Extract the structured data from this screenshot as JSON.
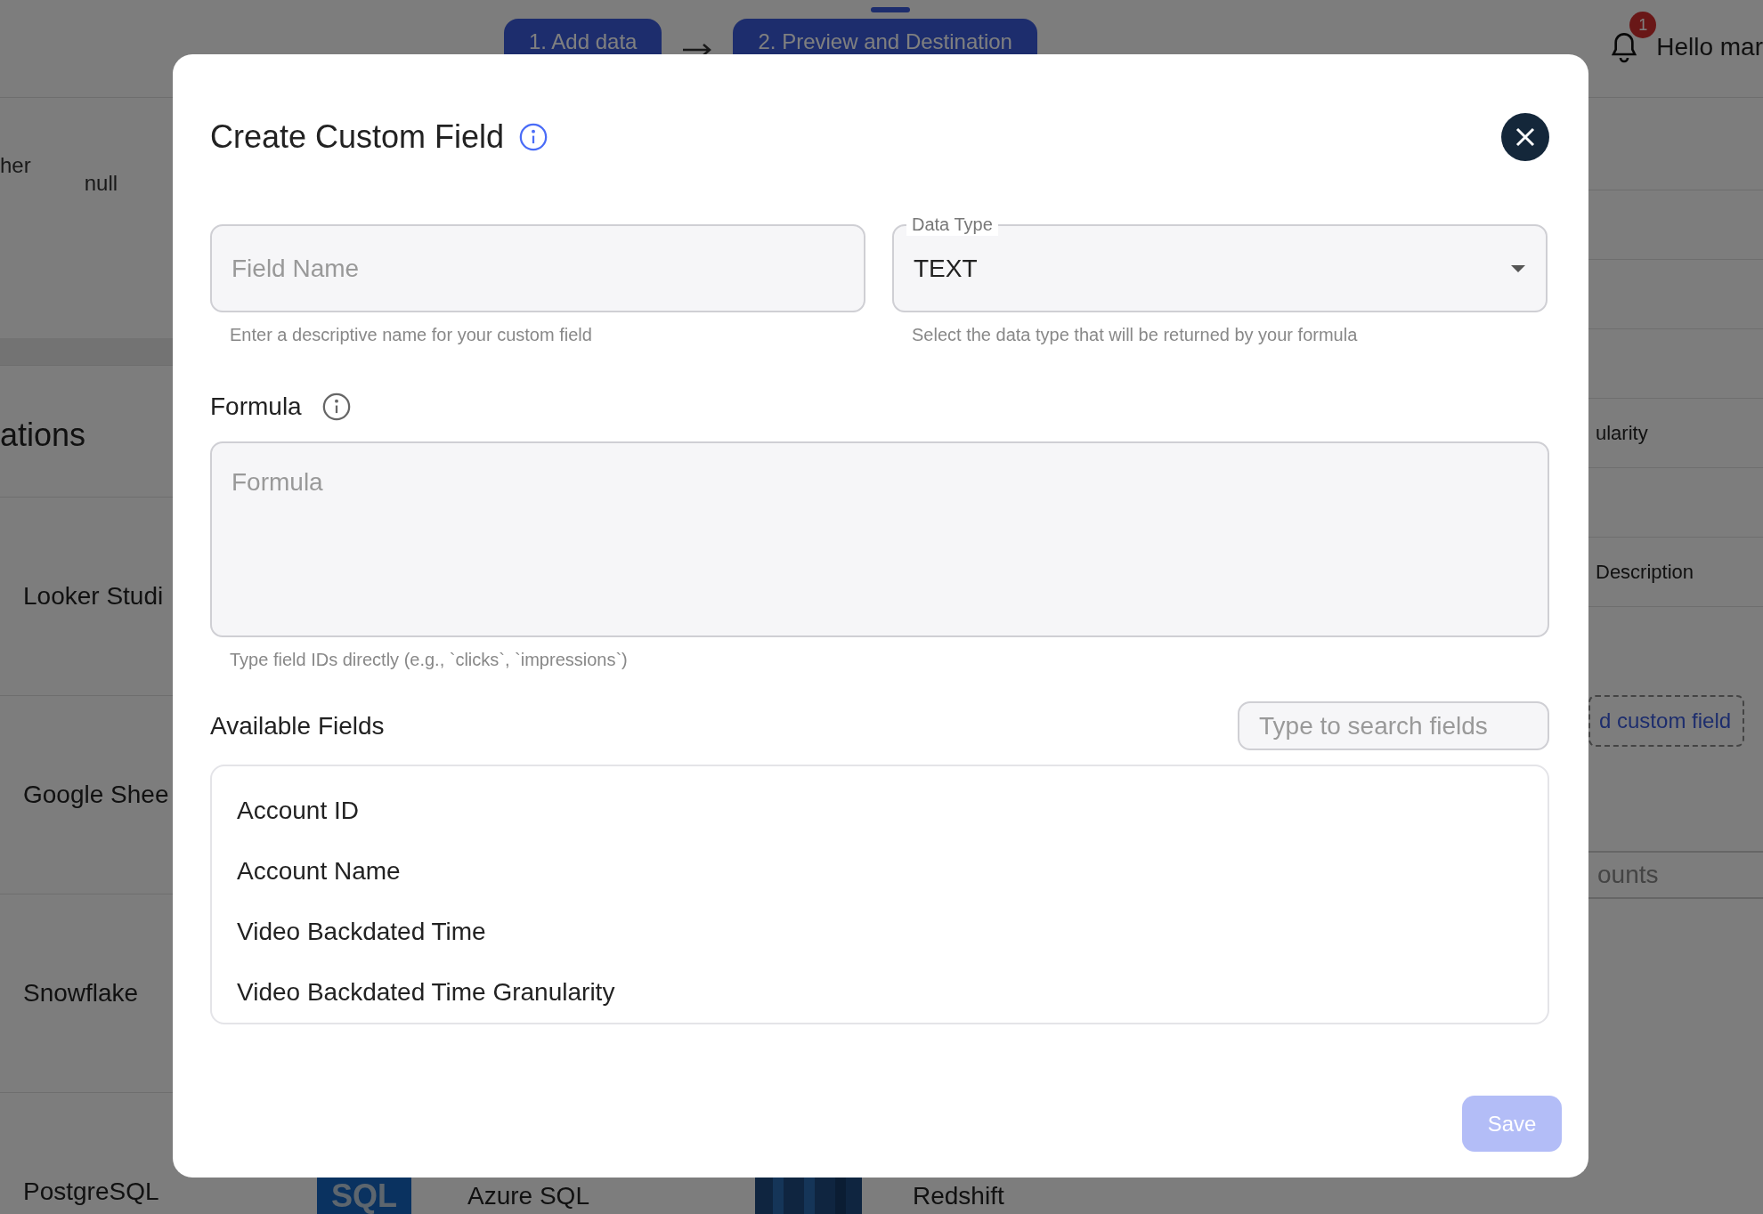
{
  "background": {
    "steps": [
      {
        "label": "1. Add data"
      },
      {
        "label": "2. Preview and Destination"
      }
    ],
    "notifications": {
      "count": "1"
    },
    "greeting": "Hello mar",
    "left_texts": {
      "column_1": "her",
      "column_2": "null",
      "section_title": "ations"
    },
    "destinations": [
      {
        "name": "Looker Studi"
      },
      {
        "name": "Google Shee"
      },
      {
        "name": "Snowflake"
      },
      {
        "name": "PostgreSQL"
      }
    ],
    "bottom_row": {
      "logo_text": "SQL",
      "items": [
        "Azure SQL",
        "Redshift"
      ]
    },
    "right_texts": [
      "ularity",
      "Description"
    ],
    "add_button": "d custom field",
    "accounts_field": "ounts"
  },
  "dialog": {
    "title": "Create Custom Field",
    "field_name": {
      "placeholder": "Field Name",
      "helper": "Enter a descriptive name for your custom field"
    },
    "data_type": {
      "label": "Data Type",
      "value": "TEXT",
      "helper": "Select the data type that will be returned by your formula"
    },
    "formula": {
      "label": "Formula",
      "placeholder": "Formula",
      "helper": "Type field IDs directly (e.g., `clicks`, `impressions`)"
    },
    "available_fields": {
      "label": "Available Fields",
      "search_placeholder": "Type to search fields",
      "items": [
        "Account ID",
        "Account Name",
        "Video Backdated Time",
        "Video Backdated Time Granularity"
      ]
    },
    "save": {
      "label": "Save",
      "disabled": true
    }
  }
}
